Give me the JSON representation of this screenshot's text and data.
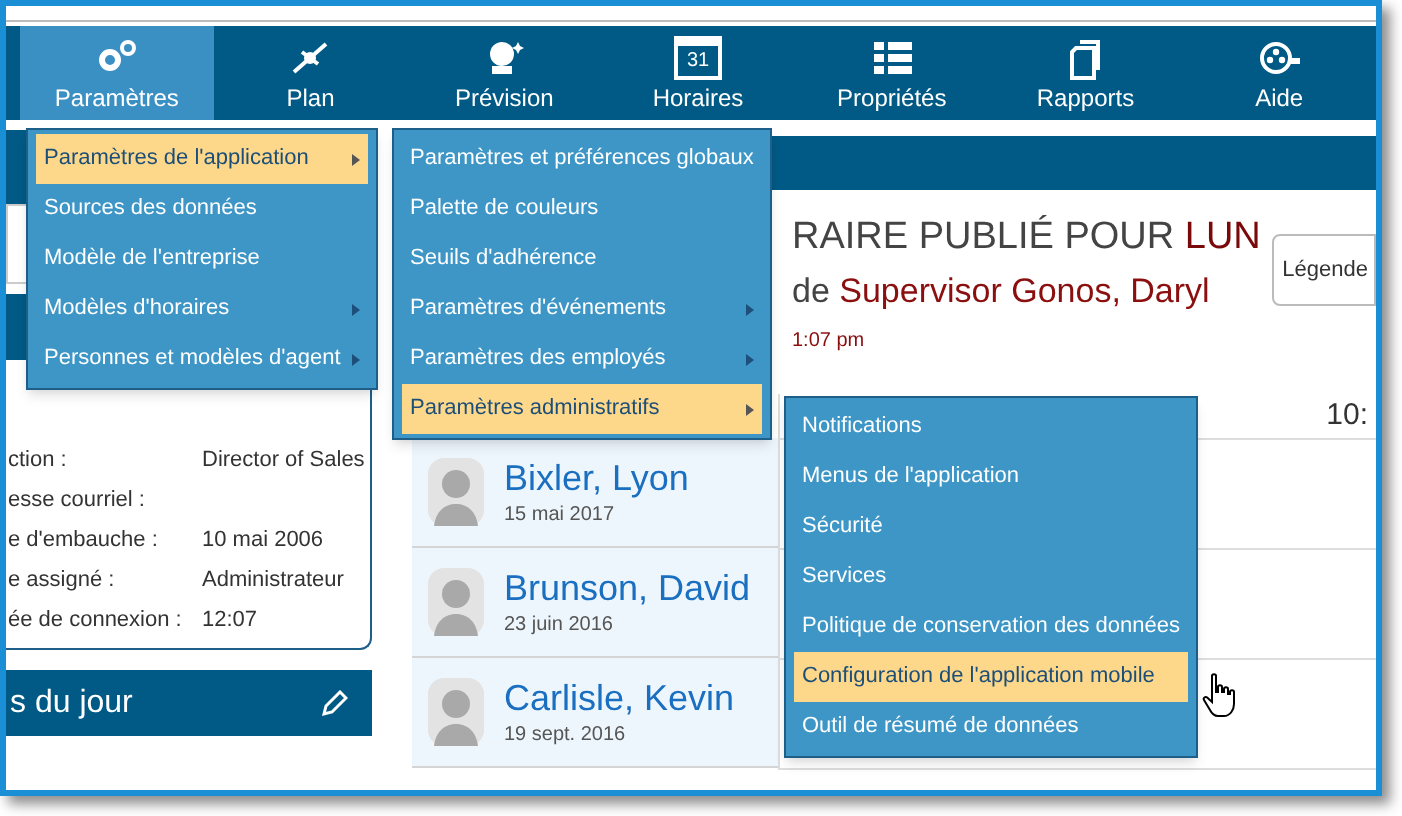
{
  "nav": [
    {
      "label": "Paramètres",
      "kind": "gears",
      "selected": true
    },
    {
      "label": "Plan",
      "kind": "compass",
      "selected": false
    },
    {
      "label": "Prévision",
      "kind": "crystal-ball",
      "selected": false
    },
    {
      "label": "Horaires",
      "kind": "calendar",
      "icon_text": "31",
      "selected": false
    },
    {
      "label": "Propriétés",
      "kind": "list",
      "selected": false
    },
    {
      "label": "Rapports",
      "kind": "documents",
      "selected": false
    },
    {
      "label": "Aide",
      "kind": "film",
      "selected": false
    }
  ],
  "profile": {
    "fields": [
      {
        "label": "ction :",
        "value": "Director of Sales"
      },
      {
        "label": "esse courriel :"
      },
      {
        "label": "e d'embauche :",
        "value": "10 mai 2006"
      },
      {
        "label": "e assigné :",
        "value": "Administrateur"
      },
      {
        "label": "ée de connexion :",
        "value": "12:07"
      }
    ]
  },
  "day_panel": {
    "title": "s du jour"
  },
  "report": {
    "title": "RAIRE PUBLIÉ POUR ",
    "title_highlight": "LUN",
    "subtitle": "de ",
    "subtitle_highlight": "Supervisor Gonos, Daryl",
    "run_time": "1:07 pm",
    "legend_button": "Légende"
  },
  "schedule": {
    "columns": [
      "10:"
    ]
  },
  "employees": [
    {
      "name": "Bixler, Lyon",
      "date": "15 mai 2017"
    },
    {
      "name": "Brunson, David",
      "date": "23 juin 2016"
    },
    {
      "name": "Carlisle, Kevin",
      "date": "19 sept. 2016"
    }
  ],
  "menus": [
    {
      "items": [
        {
          "label": "Paramètres de l'application",
          "submenu": true,
          "selected": true
        },
        {
          "label": "Sources des données",
          "submenu": false,
          "selected": false
        },
        {
          "label": "Modèle de l'entreprise",
          "submenu": false,
          "selected": false
        },
        {
          "label": "Modèles d'horaires",
          "submenu": true,
          "selected": false
        },
        {
          "label": "Personnes et modèles d'agent",
          "submenu": true,
          "selected": false
        }
      ]
    },
    {
      "items": [
        {
          "label": "Paramètres et préférences globaux",
          "submenu": false,
          "selected": false
        },
        {
          "label": "Palette de couleurs",
          "submenu": false,
          "selected": false
        },
        {
          "label": "Seuils d'adhérence",
          "submenu": false,
          "selected": false
        },
        {
          "label": "Paramètres d'événements",
          "submenu": true,
          "selected": false
        },
        {
          "label": "Paramètres des employés",
          "submenu": true,
          "selected": false
        },
        {
          "label": "Paramètres administratifs",
          "submenu": true,
          "selected": true
        }
      ]
    },
    {
      "items": [
        {
          "label": "Notifications",
          "submenu": false,
          "selected": false
        },
        {
          "label": "Menus de l'application",
          "submenu": false,
          "selected": false
        },
        {
          "label": "Sécurité",
          "submenu": false,
          "selected": false
        },
        {
          "label": "Services",
          "submenu": false,
          "selected": false
        },
        {
          "label": "Politique de conservation des données",
          "submenu": false,
          "selected": false
        },
        {
          "label": "Configuration de l'application mobile",
          "submenu": false,
          "selected": true
        },
        {
          "label": "Outil de résumé de données",
          "submenu": false,
          "selected": false
        }
      ]
    }
  ]
}
